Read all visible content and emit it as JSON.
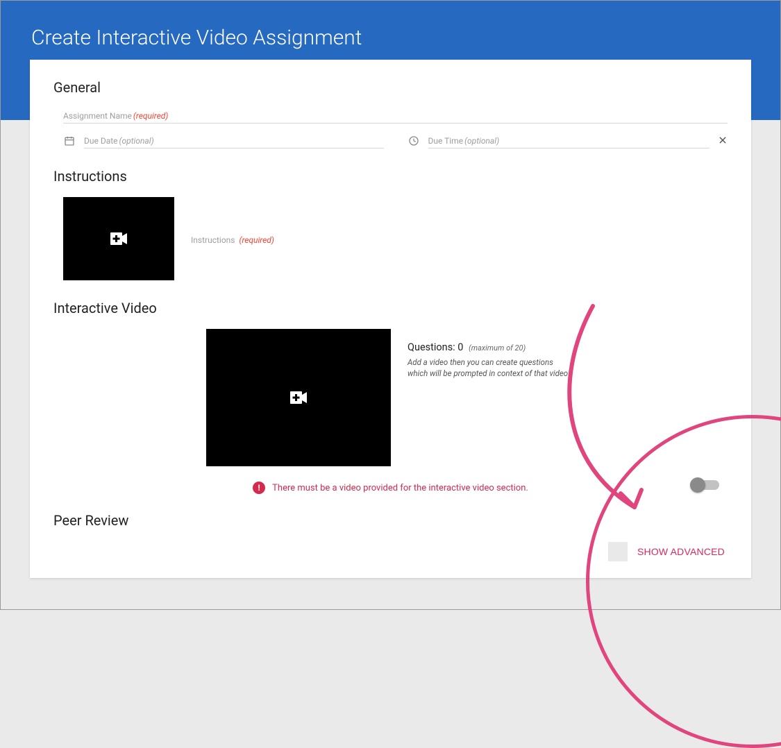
{
  "page_title": "Create Interactive Video Assignment",
  "sections": {
    "general": {
      "heading": "General",
      "assignment_name_label": "Assignment Name",
      "assignment_required_hint": "(required)",
      "due_date_label": "Due Date",
      "due_date_hint": "(optional)",
      "due_time_label": "Due Time",
      "due_time_hint": "(optional)"
    },
    "instructions": {
      "heading": "Instructions",
      "label": "Instructions",
      "required_hint": "(required)"
    },
    "interactive_video": {
      "heading": "Interactive Video",
      "questions_label": "Questions:",
      "questions_count": "0",
      "questions_max_hint": "(maximum of 20)",
      "hint_text": "Add a video then you can create questions which will be prompted in context of that video.",
      "error_text": "There must be a video provided for the interactive video section."
    },
    "peer_review": {
      "heading": "Peer Review"
    }
  },
  "actions": {
    "show_advanced_label": "SHOW ADVANCED"
  },
  "icons": {
    "calendar": "calendar-icon",
    "clock": "clock-icon",
    "close": "close-icon",
    "video_add": "video-add-icon",
    "error": "error-icon"
  },
  "colors": {
    "brand_blue": "#2669c0",
    "error_red": "#d52a4f",
    "accent_pink": "#d52a60"
  }
}
